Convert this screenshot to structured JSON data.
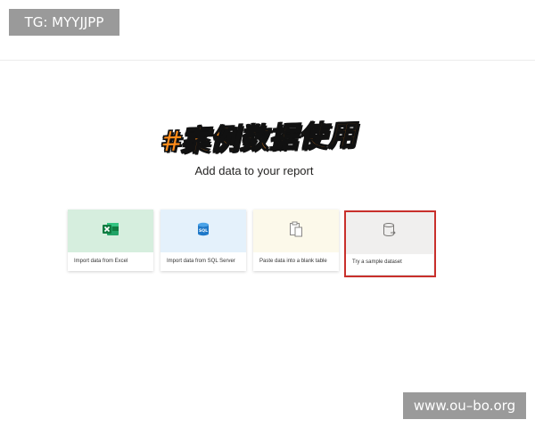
{
  "watermarks": {
    "top_left": "TG: MYYJJPP",
    "bottom_right": "www.ou–bo.org"
  },
  "overlay": {
    "hashtag": "#案例数据使用"
  },
  "main": {
    "title": "Add data to your report",
    "cards": [
      {
        "label": "Import data from Excel",
        "icon": "excel-icon",
        "tint": "#d6eede"
      },
      {
        "label": "Import data from SQL Server",
        "icon": "sql-server-icon",
        "tint": "#e4f1fb"
      },
      {
        "label": "Paste data into a blank table",
        "icon": "paste-icon",
        "tint": "#fcf9ea"
      },
      {
        "label": "Try a sample dataset",
        "icon": "sample-dataset-icon",
        "tint": "#f0efee"
      }
    ],
    "highlight_color": "#c9302c",
    "sql_badge": "SQL"
  }
}
